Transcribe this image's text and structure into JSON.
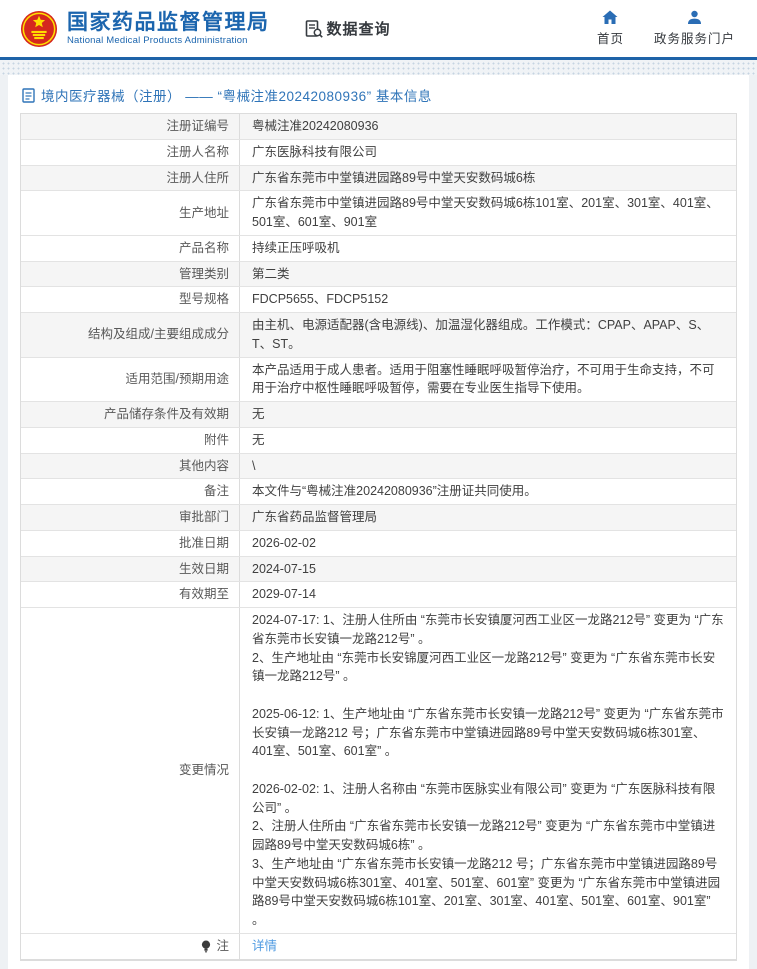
{
  "colors": {
    "brand_blue": "#1b65ae",
    "header_line": "#1e63a8",
    "breadcrumb_blue": "#2f74b8",
    "link_blue": "#4e9ae1",
    "row_shade": "#f5f5f5",
    "emblem_red": "#d5281e",
    "emblem_gold": "#ffde00"
  },
  "header": {
    "logo_title": "国家药品监督管理局",
    "logo_subtitle": "National Medical Products Administration",
    "data_query_label": "数据查询",
    "nav": [
      {
        "label": "首页",
        "icon": "home-icon"
      },
      {
        "label": "政务服务门户",
        "icon": "user-icon"
      }
    ]
  },
  "breadcrumb": {
    "text": "境内医疗器械（注册） —— “粤械注准20242080936” 基本信息"
  },
  "table": {
    "rows": [
      {
        "label": "注册证编号",
        "value": "粤械注准20242080936"
      },
      {
        "label": "注册人名称",
        "value": "广东医脉科技有限公司"
      },
      {
        "label": "注册人住所",
        "value": "广东省东莞市中堂镇进园路89号中堂天安数码城6栋"
      },
      {
        "label": "生产地址",
        "value": "广东省东莞市中堂镇进园路89号中堂天安数码城6栋101室、201室、301室、401室、501室、601室、901室"
      },
      {
        "label": "产品名称",
        "value": "持续正压呼吸机"
      },
      {
        "label": "管理类别",
        "value": "第二类"
      },
      {
        "label": "型号规格",
        "value": "FDCP5655、FDCP5152"
      },
      {
        "label": "结构及组成/主要组成成分",
        "value": "由主机、电源适配器(含电源线)、加温湿化器组成。工作模式：CPAP、APAP、S、T、ST。"
      },
      {
        "label": "适用范围/预期用途",
        "value": "本产品适用于成人患者。适用于阻塞性睡眠呼吸暂停治疗，不可用于生命支持，不可用于治疗中枢性睡眠呼吸暂停，需要在专业医生指导下使用。"
      },
      {
        "label": "产品储存条件及有效期",
        "value": "无"
      },
      {
        "label": "附件",
        "value": "无"
      },
      {
        "label": "其他内容",
        "value": "\\"
      },
      {
        "label": "备注",
        "value": "本文件与“粤械注准20242080936”注册证共同使用。"
      },
      {
        "label": "审批部门",
        "value": "广东省药品监督管理局"
      },
      {
        "label": "批准日期",
        "value": "2026-02-02"
      },
      {
        "label": "生效日期",
        "value": "2024-07-15"
      },
      {
        "label": "有效期至",
        "value": "2029-07-14"
      },
      {
        "label": "变更情况",
        "value": "2024-07-17: 1、注册人住所由 “东莞市长安镇厦河西工业区一龙路212号” 变更为 “广东省东莞市长安镇一龙路212号” 。\n2、生产地址由 “东莞市长安锦厦河西工业区一龙路212号” 变更为 “广东省东莞市长安镇一龙路212号” 。\n\n2025-06-12: 1、生产地址由 “广东省东莞市长安镇一龙路212号” 变更为 “广东省东莞市长安镇一龙路212 号；广东省东莞市中堂镇进园路89号中堂天安数码城6栋301室、401室、501室、601室” 。\n\n2026-02-02: 1、注册人名称由 “东莞市医脉实业有限公司” 变更为 “广东医脉科技有限公司” 。\n2、注册人住所由 “广东省东莞市长安镇一龙路212号” 变更为 “广东省东莞市中堂镇进园路89号中堂天安数码城6栋” 。\n3、生产地址由 “广东省东莞市长安镇一龙路212 号；广东省东莞市中堂镇进园路89号中堂天安数码城6栋301室、401室、501室、601室” 变更为 “广东省东莞市中堂镇进园路89号中堂天安数码城6栋101室、201室、301室、401室、501室、601室、901室” 。"
      }
    ],
    "note": {
      "label": "注",
      "link_label": "详情"
    }
  }
}
